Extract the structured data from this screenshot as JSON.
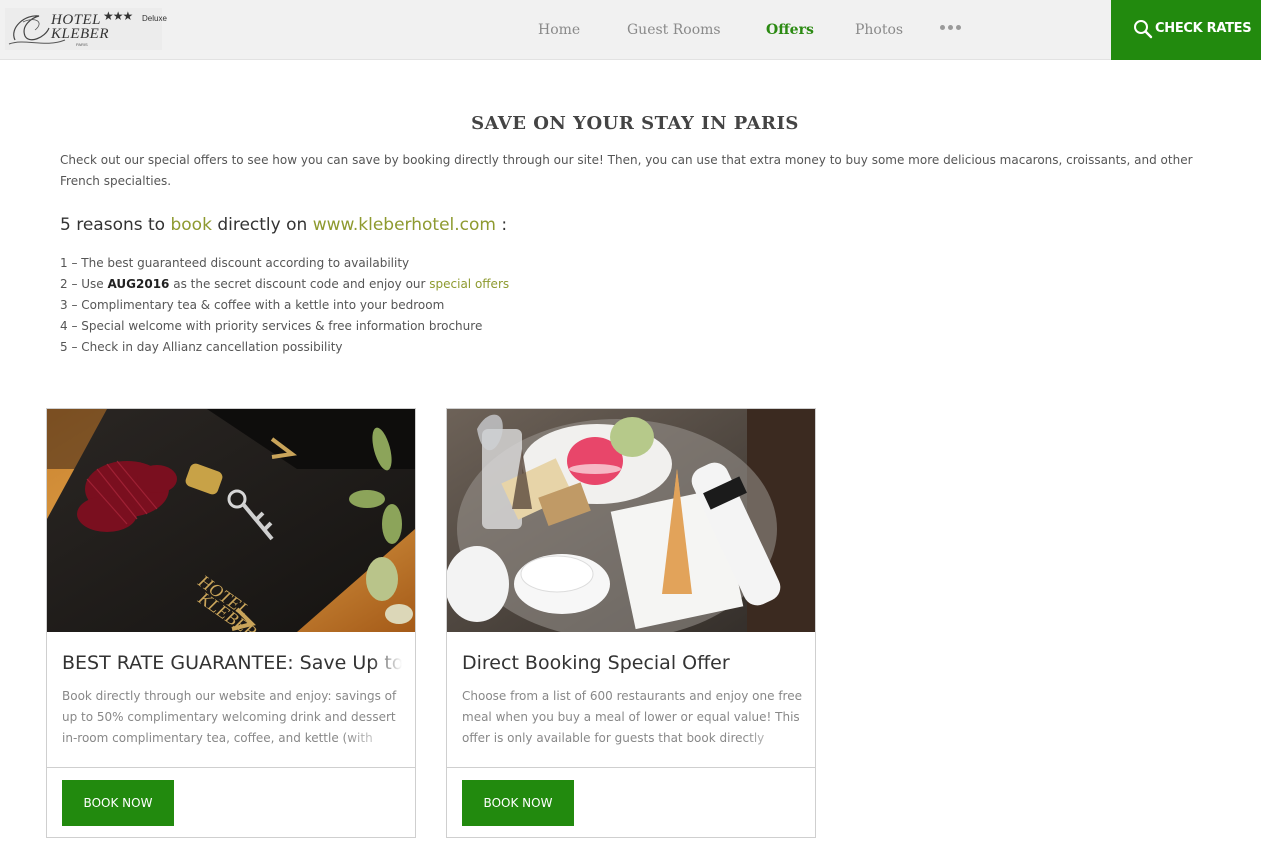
{
  "header": {
    "logo": {
      "hotel_name_line1": "HOTEL",
      "hotel_name_line2": "KLEBER",
      "stars": "★★★",
      "deluxe": "Deluxe",
      "city": "PARIS"
    },
    "nav": [
      {
        "label": "Home",
        "active": false
      },
      {
        "label": "Guest Rooms",
        "active": false
      },
      {
        "label": "Offers",
        "active": true
      },
      {
        "label": "Photos",
        "active": false
      }
    ],
    "more_icon": "more-dots-icon",
    "check_rates": {
      "label": "CHECK RATES",
      "icon": "search-icon"
    }
  },
  "main": {
    "title": "SAVE ON YOUR STAY IN PARIS",
    "intro": "Check out our special offers to see how you can save by booking directly through our site! Then, you can use that extra money to buy some more delicious macarons, croissants, and other French specialties.",
    "reasons_heading": {
      "prefix": "5 reasons to ",
      "book": "book",
      "middle": " directly on ",
      "site": "www.kleberhotel.com",
      "suffix": " :"
    },
    "reasons": {
      "r1": "1 – The best guaranteed discount according to availability",
      "r2_prefix": "2 – Use ",
      "r2_code": "AUG2016",
      "r2_middle": " as the secret discount code and enjoy our ",
      "r2_link": "special offers",
      "r3": "3 – Complimentary tea & coffee with a kettle into your bedroom",
      "r4": "4 – Special welcome with priority services & free information brochure",
      "r5": "5 – Check in day Allianz cancellation possibility"
    }
  },
  "offers": [
    {
      "title": "BEST RATE GUARANTEE: Save Up to",
      "text": "Book directly through our website and enjoy: savings of up to 50% complimentary welcoming drink and dessert in-room complimentary tea, coffee, and kettle (with",
      "button": "BOOK NOW"
    },
    {
      "title": "Direct Booking Special Offer",
      "text": "Choose from a list of 600 restaurants and enjoy one free meal when you buy a meal of lower or equal value! This offer is only available for guests that book directly",
      "button": "BOOK NOW"
    }
  ],
  "colors": {
    "brand_green": "#228a0e",
    "nav_active": "#2b8a12",
    "accent_olive": "#8e9a2f"
  }
}
